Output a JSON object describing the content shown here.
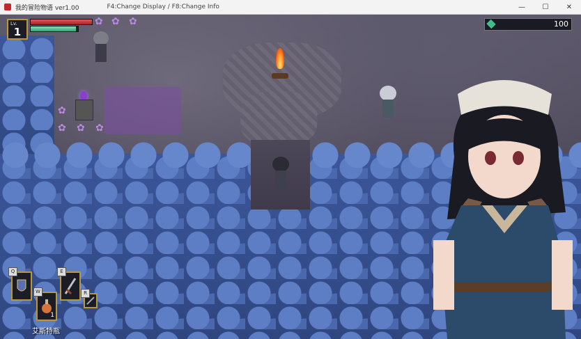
{
  "window": {
    "title": "我的冒险物语 ver1.00",
    "hint": "F4:Change Display / F8:Change Info",
    "minimize": "—",
    "maximize": "☐",
    "close": "✕"
  },
  "hud": {
    "level_label": "Lv.",
    "level": "1",
    "hp_fraction": 1.0,
    "mp_fraction": 0.95,
    "money_icon": "green-gem-icon",
    "money": "100"
  },
  "hotbar": {
    "slots": [
      {
        "key": "Q",
        "icon": "shield-icon"
      },
      {
        "key": "W",
        "icon": "potion-icon",
        "count": "1"
      },
      {
        "key": "E",
        "icon": "sword-icon"
      },
      {
        "key": "R",
        "icon": "small-item-icon"
      }
    ],
    "selected_item_name": "艾斯特瓶"
  },
  "colors": {
    "gold_border": "#b8973f",
    "hp": "#c43b3b",
    "mp": "#4cc294",
    "forest": "#3b569a"
  }
}
